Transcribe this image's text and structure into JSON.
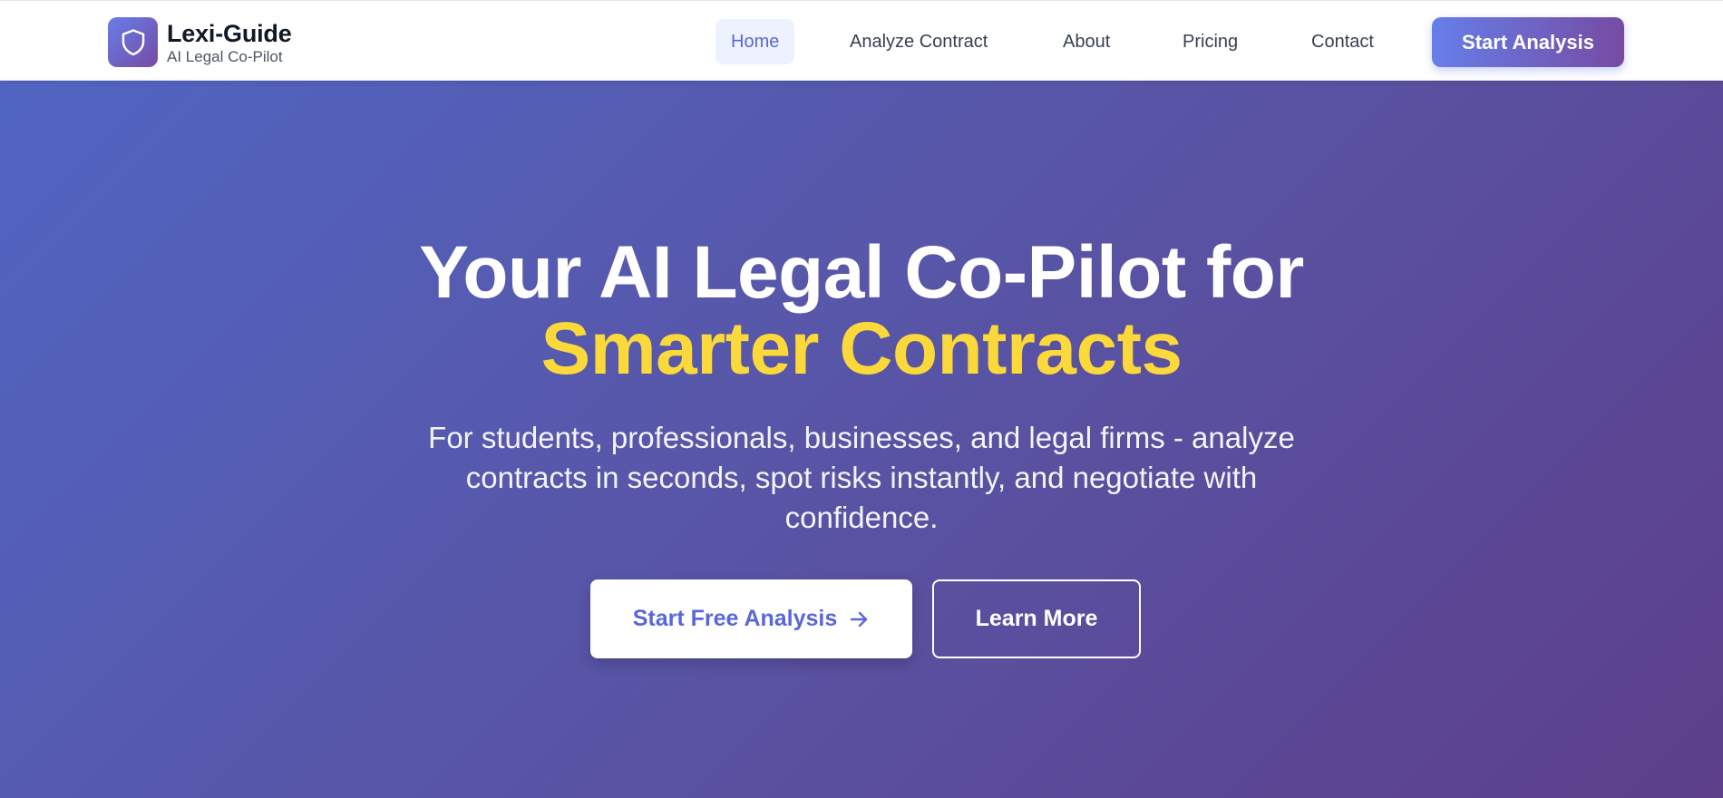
{
  "brand": {
    "name": "Lexi-Guide",
    "tagline": "AI Legal Co-Pilot",
    "logo_icon": "shield-icon"
  },
  "nav": {
    "items": [
      {
        "label": "Home",
        "active": true
      },
      {
        "label": "Analyze Contract",
        "active": false
      },
      {
        "label": "About",
        "active": false
      },
      {
        "label": "Pricing",
        "active": false
      },
      {
        "label": "Contact",
        "active": false
      }
    ],
    "cta_label": "Start Analysis"
  },
  "hero": {
    "title_line1": "Your AI Legal Co-Pilot for",
    "title_line2": "Smarter Contracts",
    "subtitle": "For students, professionals, businesses, and legal firms - analyze contracts in seconds, spot risks instantly, and negotiate with confidence.",
    "primary_button": "Start Free Analysis",
    "secondary_button": "Learn More"
  },
  "colors": {
    "accent": "#5a67d8",
    "gradient_start": "#667eea",
    "gradient_end": "#764ba2",
    "highlight": "#fcd93a"
  }
}
